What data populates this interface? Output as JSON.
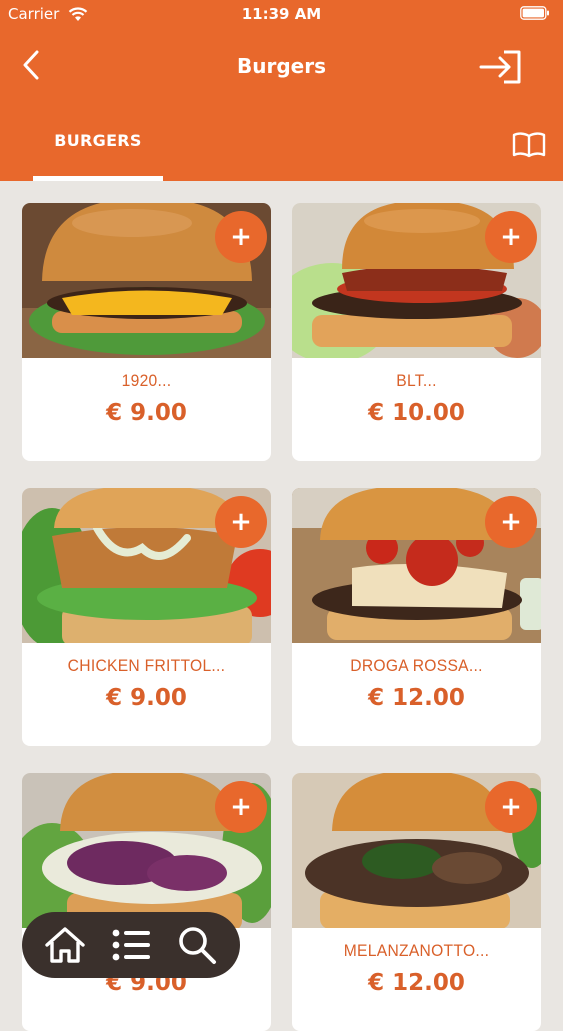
{
  "status_bar": {
    "carrier": "Carrier",
    "time": "11:39 AM"
  },
  "header": {
    "title": "Burgers"
  },
  "tabs": [
    {
      "label": "BURGERS",
      "active": true
    }
  ],
  "products": [
    {
      "name": "1920...",
      "price": "€ 9.00",
      "add_label": "+"
    },
    {
      "name": "BLT...",
      "price": "€ 10.00",
      "add_label": "+"
    },
    {
      "name": "CHICKEN FRITTOL...",
      "price": "€ 9.00",
      "add_label": "+"
    },
    {
      "name": "DROGA ROSSA...",
      "price": "€ 12.00",
      "add_label": "+"
    },
    {
      "name": "",
      "price": "€ 9.00",
      "add_label": "+"
    },
    {
      "name": "MELANZANOTTO...",
      "price": "€ 12.00",
      "add_label": "+"
    }
  ],
  "colors": {
    "accent": "#e8682c",
    "background": "#e9e6e2",
    "nav_bg": "#3a302c",
    "text_accent": "#d9602a"
  },
  "icons": {
    "back": "chevron-left-icon",
    "login": "login-icon",
    "menu": "book-icon",
    "home": "home-icon",
    "list": "list-icon",
    "search": "search-icon"
  }
}
